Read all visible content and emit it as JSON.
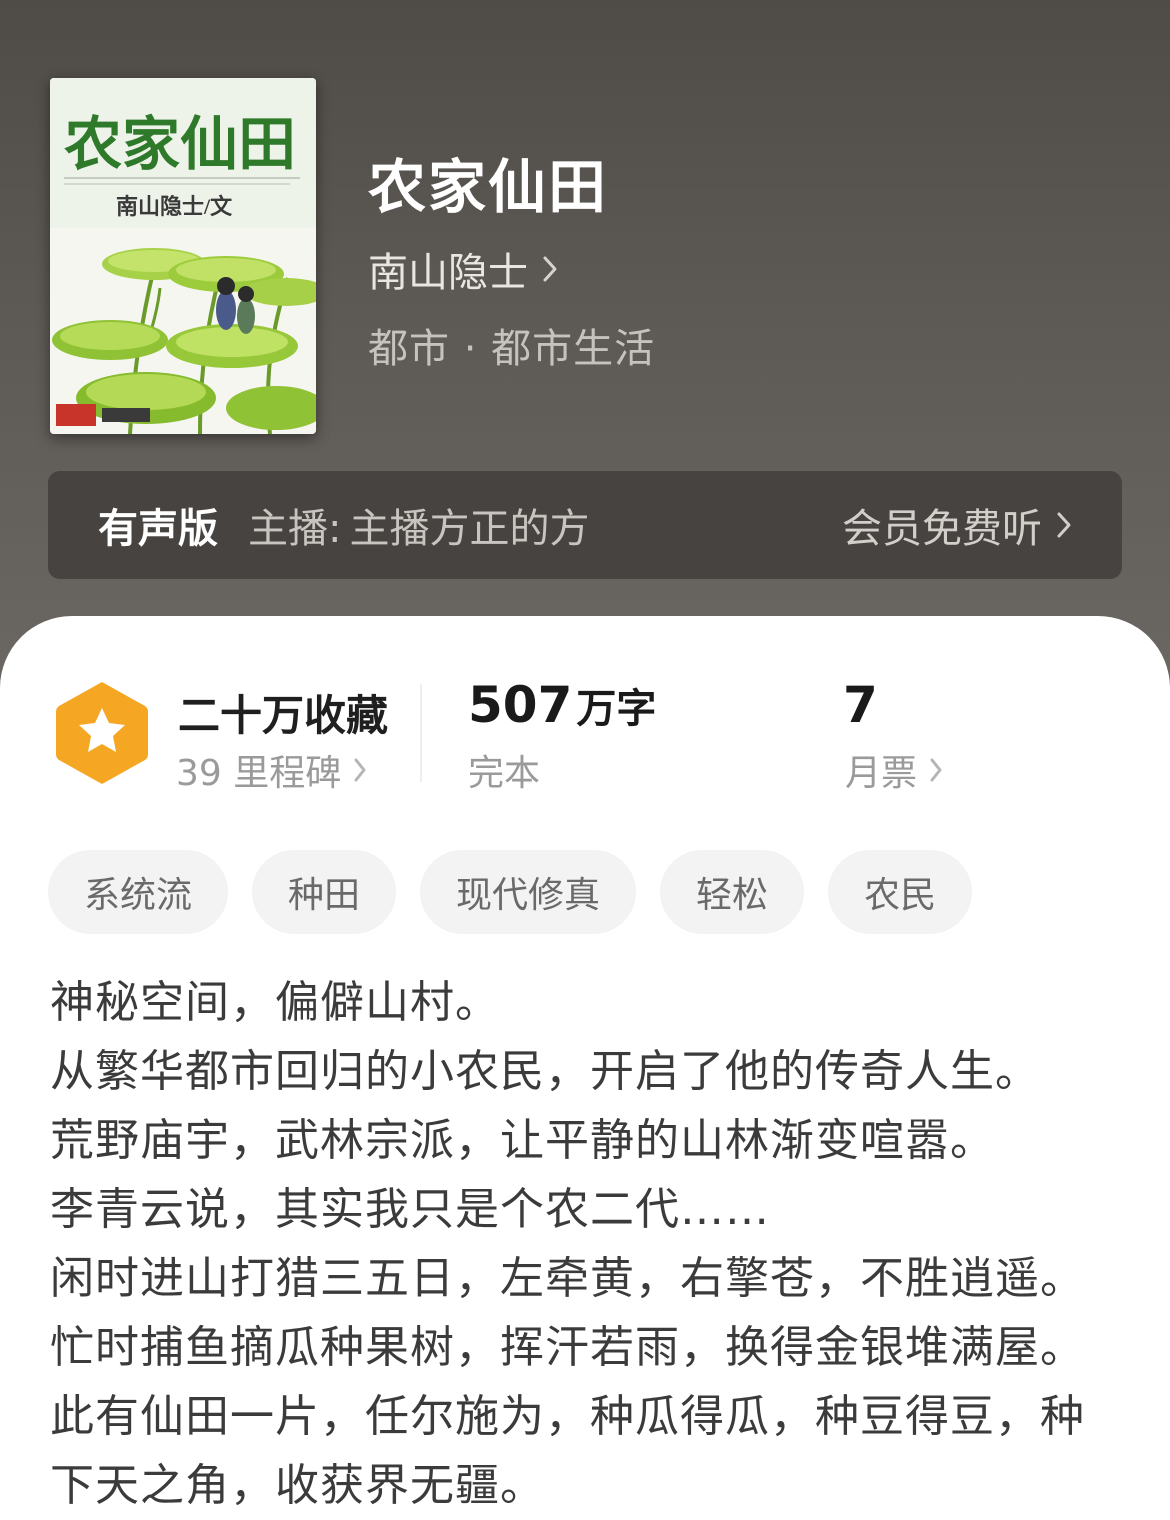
{
  "book": {
    "title": "农家仙田",
    "author": "南山隐士",
    "genre": "都市 · 都市生活",
    "cover": {
      "title": "农家仙田",
      "byline": "南山隐士/文",
      "colors": {
        "title": "#2f7a2a",
        "leaf": "#9ccc3c",
        "background": "#f4f6ef"
      }
    }
  },
  "audio": {
    "label": "有声版",
    "narrator_prefix": "主播:",
    "narrator_name": "主播方正的方",
    "cta": "会员免费听"
  },
  "stats": {
    "favorites": "二十万收藏",
    "milestones": "39 里程碑",
    "words_number": "507",
    "words_unit": "万字",
    "status": "完本",
    "monthly_tickets": "7",
    "monthly_label": "月票"
  },
  "tags": [
    "系统流",
    "种田",
    "现代修真",
    "轻松",
    "农民"
  ],
  "synopsis": [
    "神秘空间，偏僻山村。",
    "从繁华都市回归的小农民，开启了他的传奇人生。",
    "荒野庙宇，武林宗派，让平静的山林渐变喧嚣。",
    "李青云说，其实我只是个农二代……",
    "闲时进山打猎三五日，左牵黄，右擎苍，不胜逍遥。",
    "忙时捕鱼摘瓜种果树，挥汗若雨，换得金银堆满屋。",
    "此有仙田一片，任尔施为，种瓜得瓜，种豆得豆，种",
    "下天之角，收获界无疆。"
  ],
  "colors": {
    "hero_bg": "#57534f",
    "audio_bar": "#474340",
    "badge": "#f5a623",
    "tag_bg": "#f3f3f3",
    "text": "#3b3b3b"
  },
  "icons": {
    "badge": "star-hexagon-icon",
    "chevron": "chevron-right-icon"
  }
}
